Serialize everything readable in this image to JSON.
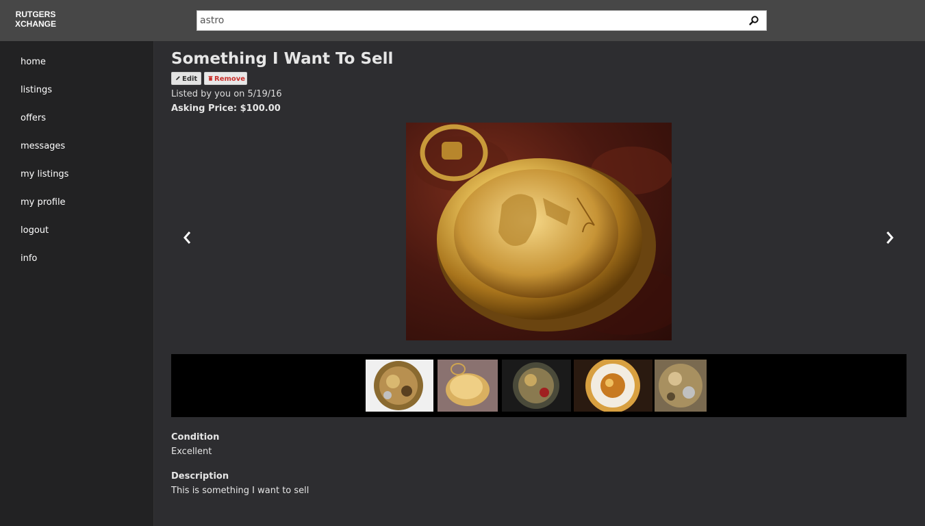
{
  "brand": {
    "line1": "RUTGERS",
    "line2": "XCHANGE"
  },
  "search": {
    "value": "astro"
  },
  "sidebar": {
    "items": [
      {
        "label": "home"
      },
      {
        "label": "listings"
      },
      {
        "label": "offers"
      },
      {
        "label": "messages"
      },
      {
        "label": "my listings"
      },
      {
        "label": "my profile"
      },
      {
        "label": "logout"
      },
      {
        "label": "info"
      }
    ]
  },
  "listing": {
    "title": "Something I Want To Sell",
    "edit_label": "Edit",
    "remove_label": "Remove",
    "listed_text": "Listed by you on 5/19/16",
    "asking_price": "Asking Price: $100.00",
    "condition_label": "Condition",
    "condition_value": "Excellent",
    "description_label": "Description",
    "description_value": "This is something I want to sell"
  },
  "colors": {
    "topbar": "#474747",
    "sidebar": "#222223",
    "main_bg": "#2d2d30",
    "remove_text": "#c9302c",
    "thumb_strip": "#000000"
  },
  "icons": {
    "search": "search-icon",
    "edit": "pencil-icon",
    "remove": "trash-icon",
    "prev": "chevron-left-icon",
    "next": "chevron-right-icon"
  }
}
